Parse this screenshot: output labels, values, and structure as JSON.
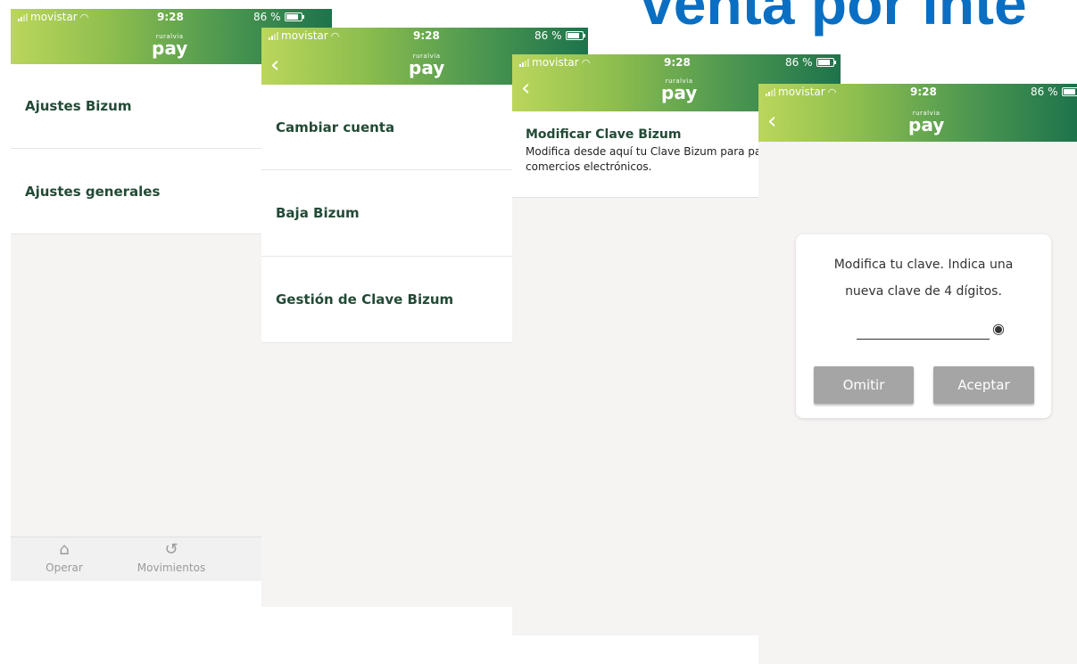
{
  "headline": "venta por inte",
  "status": {
    "carrier": "movistar",
    "time": "9:28",
    "battery": "86 %",
    "battery_level": 0.86
  },
  "logo": {
    "small": "ruralvia",
    "big": "pay"
  },
  "screen1": {
    "items": [
      "Ajustes Bizum",
      "Ajustes generales"
    ],
    "tabs": [
      {
        "label": "Operar",
        "icon": "home-icon"
      },
      {
        "label": "Movimientos",
        "icon": "history-icon"
      }
    ]
  },
  "screen2": {
    "items": [
      "Cambiar cuenta",
      "Baja Bizum",
      "Gestión de Clave Bizum"
    ]
  },
  "screen3": {
    "title": "Modificar Clave Bizum",
    "description": "Modifica desde aquí tu Clave Bizum para pagar en comercios electrónicos."
  },
  "screen4": {
    "dialog_text": "Modifica tu clave. Indica una nueva clave de 4 dígitos.",
    "omit_label": "Omitir",
    "accept_label": "Aceptar"
  },
  "colors": {
    "brand_green": "#1d734b",
    "light_green": "#bbd65c",
    "headline_blue": "#0a6fc2",
    "text_green": "#234a36"
  }
}
